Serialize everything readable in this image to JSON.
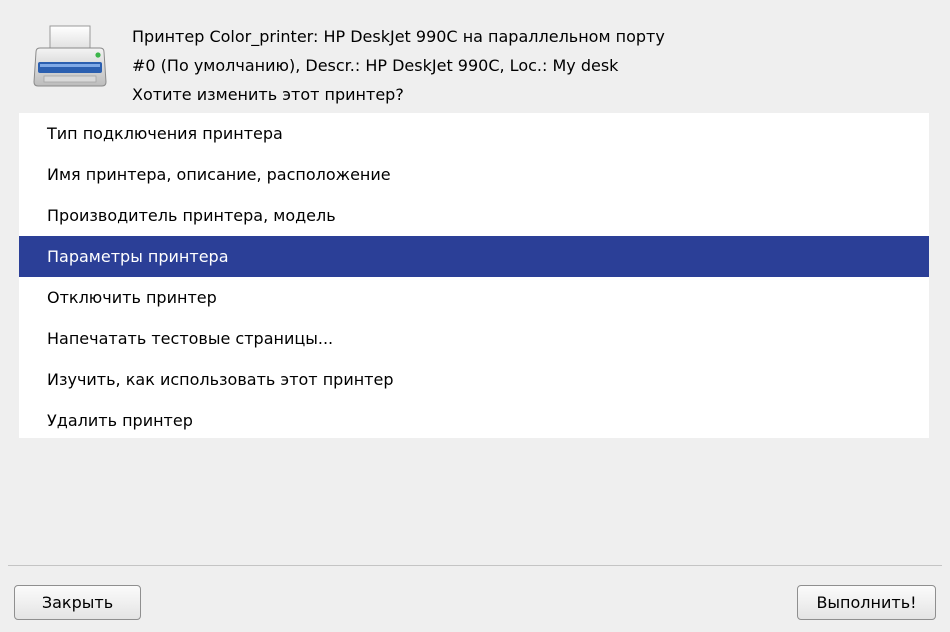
{
  "header": {
    "icon": "printer-icon",
    "line1": "Принтер Color_printer: HP DeskJet 990C на параллельном порту",
    "line2": "#0 (По умолчанию), Descr.: HP DeskJet 990C, Loc.: My desk",
    "line3": "Хотите изменить этот принтер?"
  },
  "actions": {
    "items": [
      {
        "label": "Тип подключения принтера",
        "selected": false
      },
      {
        "label": "Имя принтера, описание, расположение",
        "selected": false
      },
      {
        "label": "Производитель принтера, модель",
        "selected": false
      },
      {
        "label": "Параметры принтера",
        "selected": true
      },
      {
        "label": "Отключить принтер",
        "selected": false
      },
      {
        "label": "Напечатать тестовые страницы...",
        "selected": false
      },
      {
        "label": "Изучить, как использовать этот принтер",
        "selected": false
      },
      {
        "label": "Удалить принтер",
        "selected": false
      }
    ]
  },
  "buttons": {
    "close_label": "Закрыть",
    "apply_label": "Выполнить!"
  },
  "colors": {
    "selection": "#2b3f97",
    "background": "#efefef",
    "list_background": "#ffffff"
  }
}
